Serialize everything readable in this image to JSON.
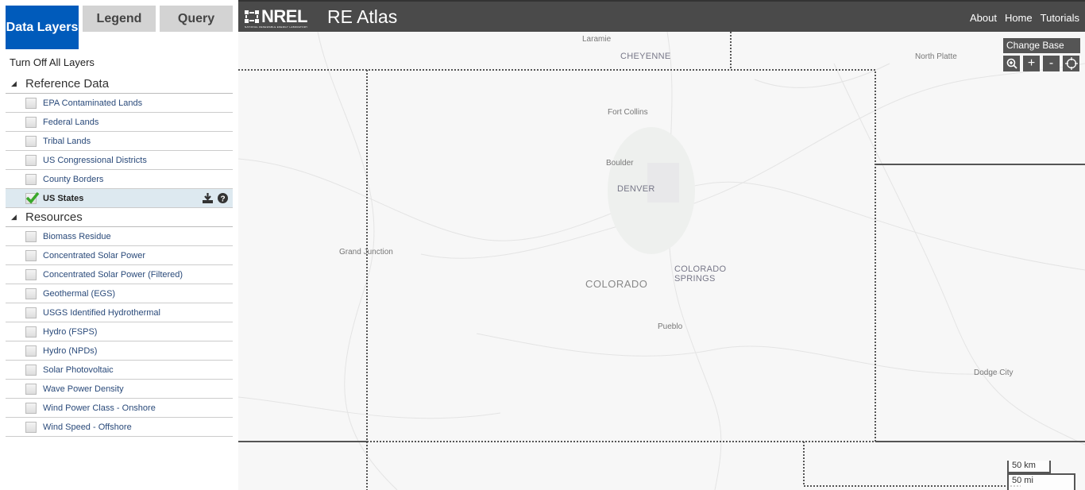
{
  "tabs": [
    {
      "label": "Data Layers"
    },
    {
      "label": "Legend"
    },
    {
      "label": "Query"
    }
  ],
  "turn_off_all": "Turn Off All Layers",
  "groups": [
    {
      "title": "Reference Data",
      "items": [
        {
          "label": "EPA Contaminated Lands",
          "checked": false
        },
        {
          "label": "Federal Lands",
          "checked": false
        },
        {
          "label": "Tribal Lands",
          "checked": false
        },
        {
          "label": "US Congressional Districts",
          "checked": false
        },
        {
          "label": "County Borders",
          "checked": false
        },
        {
          "label": "US States",
          "checked": true
        }
      ]
    },
    {
      "title": "Resources",
      "items": [
        {
          "label": "Biomass Residue",
          "checked": false
        },
        {
          "label": "Concentrated Solar Power",
          "checked": false
        },
        {
          "label": "Concentrated Solar Power (Filtered)",
          "checked": false
        },
        {
          "label": "Geothermal (EGS)",
          "checked": false
        },
        {
          "label": "USGS Identified Hydrothermal",
          "checked": false
        },
        {
          "label": "Hydro (FSPS)",
          "checked": false
        },
        {
          "label": "Hydro (NPDs)",
          "checked": false
        },
        {
          "label": "Solar Photovoltaic",
          "checked": false
        },
        {
          "label": "Wave Power Density",
          "checked": false
        },
        {
          "label": "Wind Power Class - Onshore",
          "checked": false
        },
        {
          "label": "Wind Speed - Offshore",
          "checked": false
        }
      ]
    }
  ],
  "header": {
    "logo": "NREL",
    "logo_sub": "NATIONAL RENEWABLE ENERGY LABORATORY",
    "title": "RE Atlas",
    "nav": [
      "About",
      "Home",
      "Tutorials"
    ]
  },
  "map": {
    "change_base": "Change Base",
    "controls": [
      "zoom-box",
      "+",
      "-",
      "locate"
    ],
    "cities": [
      "Laramie",
      "CHEYENNE",
      "North Platte",
      "Fort Collins",
      "Boulder",
      "DENVER",
      "Grand Junction",
      "COLORADO SPRINGS",
      "COLORADO",
      "Pueblo",
      "Dodge City"
    ],
    "scale": {
      "km": "50 km",
      "mi": "50 mi"
    }
  },
  "colors": {
    "tab_active": "#005bbb",
    "header": "#4a4a4a",
    "selected_row": "#dde9f0",
    "check": "#3aa82c"
  }
}
